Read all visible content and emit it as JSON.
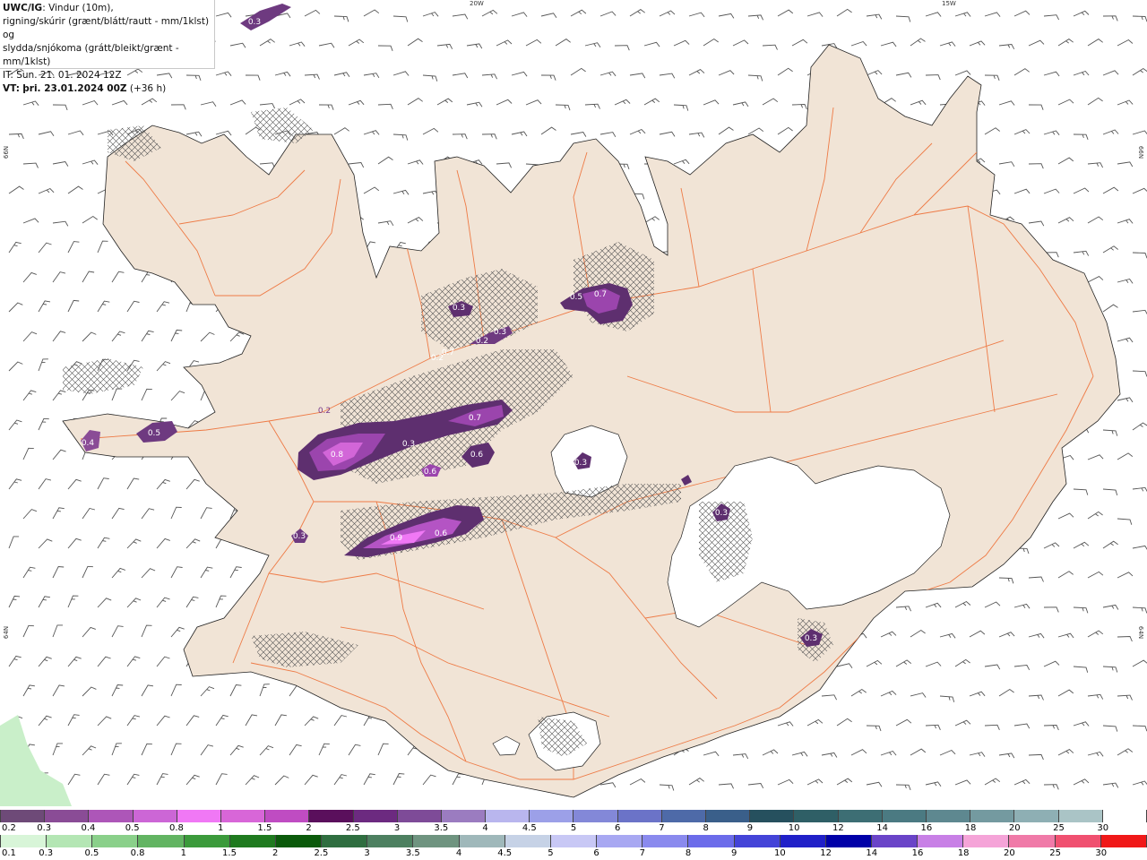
{
  "header": {
    "model": "UWC/IG",
    "line1_rest": ": Vindur (10m),",
    "line2": "rigning/skúrir (grænt/blátt/rautt - mm/1klst) og",
    "line3": "slydda/snjókoma (grátt/bleikt/grænt - mm/1klst)",
    "line4": "IT: Sun. 21. 01. 2024 12Z",
    "vt_label": "VT:",
    "vt_value": "þri. 23.01.2024 00Z",
    "vt_lead": "(+36 h)"
  },
  "coords": {
    "lon_20w": "20W",
    "lon_15w": "15W",
    "lat_66n_left": "66N",
    "lat_66n_right": "66N",
    "lat_64n_left": "64N",
    "lat_64n_right": "64N"
  },
  "amounts": [
    "0.3",
    "0.3",
    "0.2",
    "0.3",
    "0.2",
    "0.7",
    "0.5",
    "0.7",
    "0.4",
    "0.5",
    "0.7",
    "0.3",
    "0.8",
    "0.6",
    "0.6",
    "0.3",
    "0.9",
    "0.6",
    "0.3",
    "0.3",
    "0.3",
    "0.2"
  ],
  "colors": {
    "land": "#f1e4d6",
    "sea": "#ffffff",
    "roads": "#ee7a45",
    "glacier": "#ffffff",
    "wind": "#555555"
  },
  "scale_top": {
    "labels": [
      "0.2",
      "0.3",
      "0.4",
      "0.5",
      "0.8",
      "1",
      "1.5",
      "2",
      "2.5",
      "3",
      "3.5",
      "4",
      "4.5",
      "5",
      "6",
      "7",
      "8",
      "9",
      "10",
      "12",
      "14",
      "16",
      "18",
      "20",
      "25",
      "30"
    ],
    "colors": [
      "#6e4a78",
      "#8a4c96",
      "#ad56b8",
      "#cc66d6",
      "#f078f5",
      "#d866d8",
      "#bf4cc2",
      "#5a0f5c",
      "#6c2a80",
      "#7e4b98",
      "#9b7cc0",
      "#b9b6ee",
      "#9ca0e8",
      "#8388d8",
      "#6b73c8",
      "#4e6aa8",
      "#3a5f8a",
      "#26505e",
      "#2f5f66",
      "#3d6e74",
      "#4b7a82",
      "#5e8890",
      "#749aa0",
      "#8eafb4",
      "#aac4c6",
      "#ffffff"
    ]
  },
  "scale_bottom": {
    "labels": [
      "0.1",
      "0.3",
      "0.5",
      "0.8",
      "1",
      "1.5",
      "2",
      "2.5",
      "3",
      "3.5",
      "4",
      "4.5",
      "5",
      "6",
      "7",
      "8",
      "9",
      "10",
      "12",
      "14",
      "16",
      "18",
      "20",
      "25",
      "30"
    ],
    "colors": [
      "#d8f5d8",
      "#b4e6b4",
      "#8ad08a",
      "#62b462",
      "#3b9a3b",
      "#1f7a1f",
      "#0b5a0b",
      "#2f6e40",
      "#4d8060",
      "#6f9480",
      "#9fb8ba",
      "#c6d2e6",
      "#c8c8f5",
      "#a8a8f2",
      "#8a8aee",
      "#6c6cea",
      "#4444d8",
      "#2020c8",
      "#0000a8",
      "#6a44c8",
      "#c880e6",
      "#f5a4d8",
      "#f07aa8",
      "#f05070",
      "#f01818"
    ]
  }
}
